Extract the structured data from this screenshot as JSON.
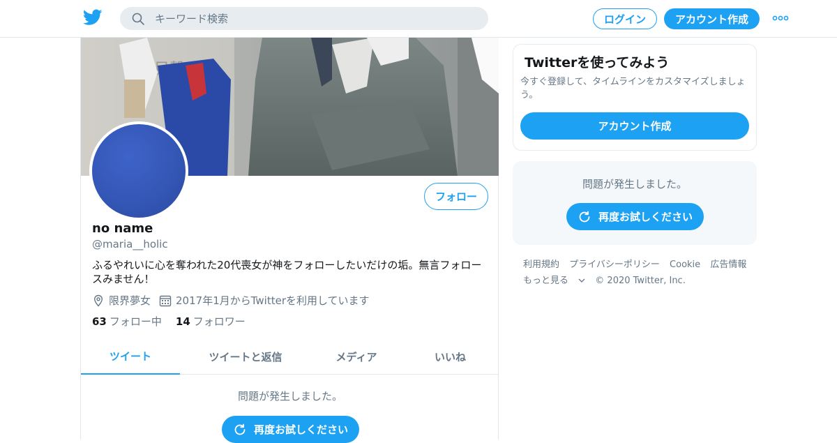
{
  "header": {
    "search": {
      "placeholder": "キーワード検索"
    },
    "login_label": "ログイン",
    "signup_label": "アカウント作成",
    "icons": {
      "logo": "twitter-bird-icon",
      "search": "search-icon",
      "more": "more-dots-icon"
    },
    "colors": {
      "accent": "#1da1f2"
    }
  },
  "profile": {
    "follow_label": "フォロー",
    "name": "no name",
    "handle": "@maria__holic",
    "bio": "ふるやれいに心を奪われた20代喪女が神をフォローしたいだけの垢。無言フォロースみません！",
    "location": "限界夢女",
    "joined": "2017年1月からTwitterを利用しています",
    "following_count": "63",
    "following_label": "フォロー中",
    "followers_count": "14",
    "followers_label": "フォロワー",
    "tabs": [
      {
        "label": "ツイート",
        "active": true
      },
      {
        "label": "ツイートと返信",
        "active": false
      },
      {
        "label": "メディア",
        "active": false
      },
      {
        "label": "いいね",
        "active": false
      }
    ],
    "error": {
      "message": "問題が発生しました。",
      "retry_label": "再度お試しください"
    }
  },
  "sidebar": {
    "signup_card": {
      "title": "Twitterを使ってみよう",
      "subtitle": "今すぐ登録して、タイムラインをカスタマイズしましょう。",
      "button_label": "アカウント作成"
    },
    "error": {
      "message": "問題が発生しました。",
      "retry_label": "再度お試しください"
    },
    "footer": {
      "links": [
        "利用規約",
        "プライバシーポリシー",
        "Cookie",
        "広告情報"
      ],
      "more_label": "もっと見る",
      "copyright": "© 2020 Twitter, Inc."
    }
  }
}
